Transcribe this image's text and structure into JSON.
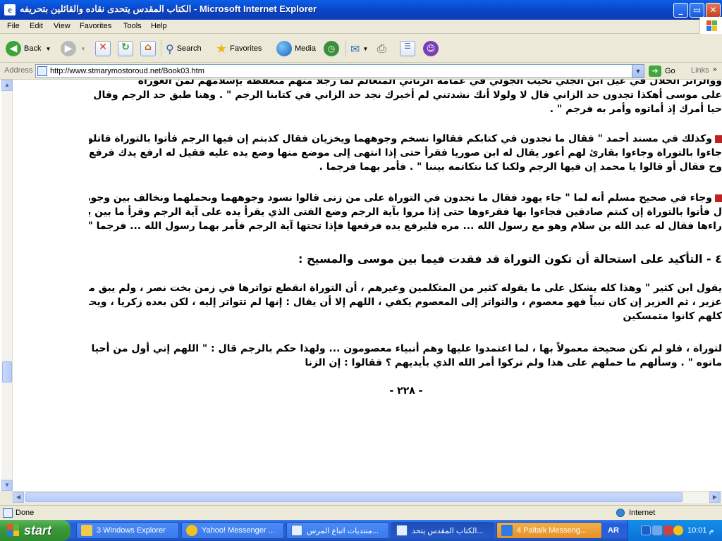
{
  "window": {
    "title": "الكتاب المقدس يتحدى نقاده والقائلين بتحريفه - Microsoft Internet Explorer",
    "min_glyph": "_",
    "max_glyph": "▭",
    "close_glyph": "✕"
  },
  "menu": [
    "File",
    "Edit",
    "View",
    "Favorites",
    "Tools",
    "Help"
  ],
  "toolbar": {
    "back": "Back",
    "search": "Search",
    "favorites": "Favorites",
    "media": "Media"
  },
  "address": {
    "label": "Address",
    "url": "http://www.stmarymostoroud.net/Book03.htm",
    "go": "Go",
    "links": "Links"
  },
  "article": {
    "para1": [
      "ووالراثر الحلال في عيل ابن الجلي نحيب الجولي في عمامة الرتاني المتعالم لما رجلاً منهم منعفظة بإسلامهم لمن الغوراة",
      "على موسى أهكذا تجدون حد الزاني قال لا ولولا أنك نشدتني لم أخبرك نجد حد الزاني في كتابنا الرجم \" . وهنا طبق حد الرجم وقال \" اللهم إني أول من",
      "حيا أمرك إذ أماتوه وأمر به فرجم \" ."
    ],
    "para2": [
      "وكذلك في مسند أحمد \" فقال ما تجدون في كتابكم فقالوا نسخم وجوههما ويخزيان فقال كذبتم إن فيها الرجم فأتوا بالتوراة فاتلوها إن كنتم صادقين",
      "جاءوا بالتوراة وجاءوا بقارئ لهم أعور يقال له ابن صوريا فقرأ حتى إذا انتهى إلى موضع منها وضع يده عليه فقيل له ارفع يدك فرفع يده فإذا هي",
      "وح فقال أو قالوا يا محمد إن فيها الرجم ولكنا كنا نتكاتمه بيننا \" . فأمر بهما فرجما ."
    ],
    "para3": [
      "وجاء في صحيح مسلم أنه لما \" جاء يهود فقال ما تجدون في التوراة على من زنى قالوا نسود وجوههما ونحملهما ونخالف بين وجوههما ويطاف بهما",
      "ل فأتوا بالتوراة إن كنتم صادقين فجاءوا بها فقرءوها حتى إذا مروا بآية الرجم وضع الفتى الذي يقرأ يده على آية الرجم وقرأ ما بين يديها وما",
      "راءها فقال له عبد الله بن سلام وهو مع رسول الله ... مره فليرفع يده فرفعها فإذا تحتها آية الرجم فأمر بهما رسول الله ... فرجما \" ."
    ],
    "heading": "٤ - التأكيد على استحالة أن تكون التوراة قد فقدت فيما بين موسى والمسيح :",
    "para4": [
      "يقول ابن كثير \" وهذا كله يشكل على ما يقوله كثير من المتكلمين وغيرهم ، أن التوراة انقطع تواترها في زمن بخت نصر ، ولم يبق من يحفظها إلا",
      "عزير ، ثم العزير إن كان نبياً فهو معصوم ، والتواتر إلى المعصوم يكفي ، اللهم إلا أن يقال : إنها لم تتواتر إليه ، لكن بعده زكريا ، ويحيى ، وعيسى ،",
      "كلهم كانوا متمسكين"
    ],
    "para5": [
      "لتوراة ، فلو لم تكن صحيحة معمولاً بها ، لما اعتمدوا عليها وهم أنبياء معصومون ... ولهذا حكم بالرجم قال : \" اللهم إني أول من أحيا أمرك إذ",
      "ماتوه \" . وسألهم ما حملهم على هذا ولم تركوا أمر الله الذي بأيديهم ؟ فقالوا : إن الزنا"
    ],
    "page_number": "- ٢٢٨ -"
  },
  "status": {
    "text": "Done",
    "zone": "Internet"
  },
  "taskbar": {
    "start": "start",
    "tasks": [
      "3 Windows Explorer",
      "Yahoo! Messenger ...",
      "منتديات اتباع المرس...",
      "الكتاب المقدس يتحد...",
      "4 Paltalk Messeng..."
    ],
    "lang": "AR",
    "clock": "10:01 م"
  },
  "colors": {
    "title_blue": "#0A46C8",
    "start_green": "#3a9a3a",
    "taskbar_blue": "#245edb",
    "bullet_red": "#c02020"
  }
}
